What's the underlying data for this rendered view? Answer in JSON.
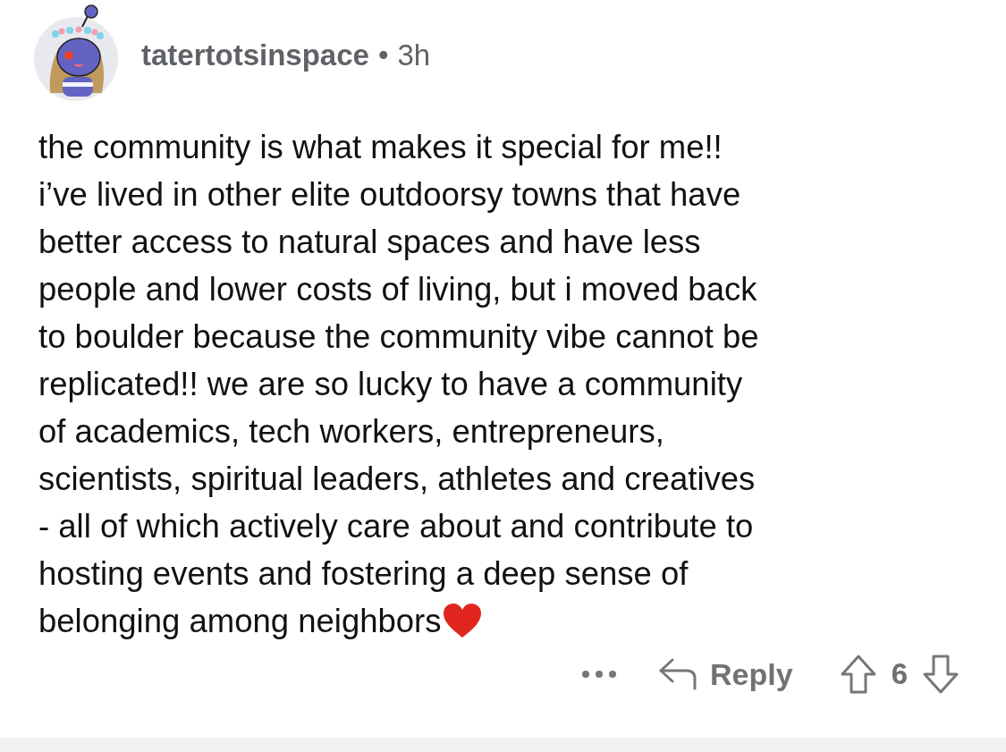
{
  "comment": {
    "username": "tatertotsinspace",
    "separator": "•",
    "age": "3h",
    "body": "the community is what makes it special for me!!\ni’ve lived in other elite outdoorsy towns that have\nbetter access to natural spaces and have less\npeople and lower costs of living, but i moved back\nto boulder because the community vibe cannot be\nreplicated!! we are so lucky to have a community\nof academics, tech workers, entrepreneurs,\nscientists, spiritual leaders, athletes and creatives\n- all of which actively care about and contribute to\nhosting events and fostering a deep sense of\nbelonging among neighbors",
    "reply_label": "Reply",
    "score": "6"
  }
}
